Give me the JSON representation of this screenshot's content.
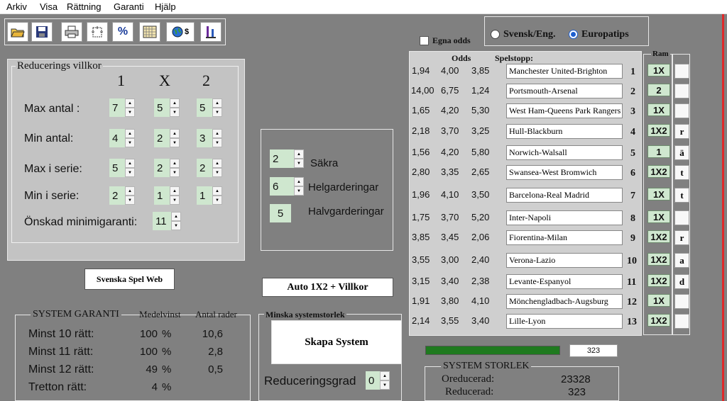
{
  "menu": [
    "Arkiv",
    "Visa",
    "Rättning",
    "Garanti",
    "Hjälp"
  ],
  "toolbar": [
    "open-icon",
    "save-icon",
    "print-icon",
    "settings-icon",
    "percent-icon",
    "grid-icon",
    "globe-currency-icon",
    "scale-icon"
  ],
  "odds_type": {
    "label": "Egna odds",
    "checked": false
  },
  "source": {
    "options": [
      "Svensk/Eng.",
      "Europatips"
    ],
    "selected": "Europatips"
  },
  "reducering": {
    "title": "Reducerings villkor",
    "cols": [
      "1",
      "X",
      "2"
    ],
    "rows": [
      {
        "label": "Max antal :",
        "values": [
          "7",
          "5",
          "5"
        ]
      },
      {
        "label": "Min antal:",
        "values": [
          "4",
          "2",
          "3"
        ]
      },
      {
        "label": "Max i serie:",
        "values": [
          "5",
          "2",
          "2"
        ]
      },
      {
        "label": "Min i serie:",
        "values": [
          "2",
          "1",
          "1"
        ]
      }
    ],
    "garanti_label": "Önskad minimigaranti:",
    "garanti_value": "11"
  },
  "system": {
    "sakra": {
      "value": "2",
      "label": "Säkra"
    },
    "helg": {
      "value": "6",
      "label": "Helgarderingar"
    },
    "halv": {
      "value": "5",
      "label": "Halvgarderingar"
    }
  },
  "buttons": {
    "web": "Svenska Spel Web",
    "auto": "Auto 1X2 + Villkor",
    "skapa": "Skapa System"
  },
  "minska": {
    "title": "Minska systemstorlek",
    "label": "Reduceringsgrad",
    "value": "0"
  },
  "garanti": {
    "headers": [
      "SYSTEM GARANTI",
      "Medelvinst",
      "Antal rader"
    ],
    "rows": [
      {
        "label": "Minst 10 rätt:",
        "pct": "100",
        "unit": "%",
        "rader": "10,6"
      },
      {
        "label": "Minst 11 rätt:",
        "pct": "100",
        "unit": "%",
        "rader": "2,8"
      },
      {
        "label": "Minst 12 rätt:",
        "pct": "49",
        "unit": "%",
        "rader": "0,5"
      },
      {
        "label": "Tretton rätt:",
        "pct": "4",
        "unit": "%",
        "rader": ""
      }
    ]
  },
  "odds_headers": {
    "odds": "Odds",
    "spelstopp": "Spelstopp:",
    "ram": "Ram"
  },
  "matches": [
    {
      "o1": "1,94",
      "ox": "4,00",
      "o2": "3,85",
      "match": "Manchester United-Brighton",
      "num": "1",
      "ram": "1X",
      "side": ""
    },
    {
      "o1": "14,00",
      "ox": "6,75",
      "o2": "1,24",
      "match": "Portsmouth-Arsenal",
      "num": "2",
      "ram": "2",
      "side": ""
    },
    {
      "o1": "1,65",
      "ox": "4,20",
      "o2": "5,30",
      "match": "West Ham-Queens Park Rangers",
      "num": "3",
      "ram": "1X",
      "side": ""
    },
    {
      "o1": "2,18",
      "ox": "3,70",
      "o2": "3,25",
      "match": "Hull-Blackburn",
      "num": "4",
      "ram": "1X2",
      "side": "r"
    },
    {
      "o1": "1,56",
      "ox": "4,20",
      "o2": "5,80",
      "match": "Norwich-Walsall",
      "num": "5",
      "ram": "1",
      "side": "ä"
    },
    {
      "o1": "2,80",
      "ox": "3,35",
      "o2": "2,65",
      "match": "Swansea-West Bromwich",
      "num": "6",
      "ram": "1X2",
      "side": "t"
    },
    {
      "o1": "1,96",
      "ox": "4,10",
      "o2": "3,50",
      "match": "Barcelona-Real Madrid",
      "num": "7",
      "ram": "1X",
      "side": "t"
    },
    {
      "o1": "1,75",
      "ox": "3,70",
      "o2": "5,20",
      "match": "Inter-Napoli",
      "num": "8",
      "ram": "1X",
      "side": ""
    },
    {
      "o1": "3,85",
      "ox": "3,45",
      "o2": "2,06",
      "match": "Fiorentina-Milan",
      "num": "9",
      "ram": "1X2",
      "side": "r"
    },
    {
      "o1": "3,55",
      "ox": "3,00",
      "o2": "2,40",
      "match": "Verona-Lazio",
      "num": "10",
      "ram": "1X2",
      "side": "a"
    },
    {
      "o1": "3,15",
      "ox": "3,40",
      "o2": "2,38",
      "match": "Levante-Espanyol",
      "num": "11",
      "ram": "1X2",
      "side": "d"
    },
    {
      "o1": "1,91",
      "ox": "3,80",
      "o2": "4,10",
      "match": "Mönchengladbach-Augsburg",
      "num": "12",
      "ram": "1X",
      "side": ""
    },
    {
      "o1": "2,14",
      "ox": "3,55",
      "o2": "3,40",
      "match": "Lille-Lyon",
      "num": "13",
      "ram": "1X2",
      "side": ""
    }
  ],
  "progress": {
    "fraction": 1.0,
    "value": "323"
  },
  "storlek": {
    "title": "SYSTEM STORLEK",
    "oreducerad_label": "Oreducerad:",
    "oreducerad": "23328",
    "reducerad_label": "Reducerad:",
    "reducerad": "323"
  },
  "colors": {
    "background": "#808080",
    "panel": "#c3c3c3",
    "spin_value": "#cfe7cf",
    "progress": "#1f7a1f",
    "accent_line": "#e0292a"
  }
}
